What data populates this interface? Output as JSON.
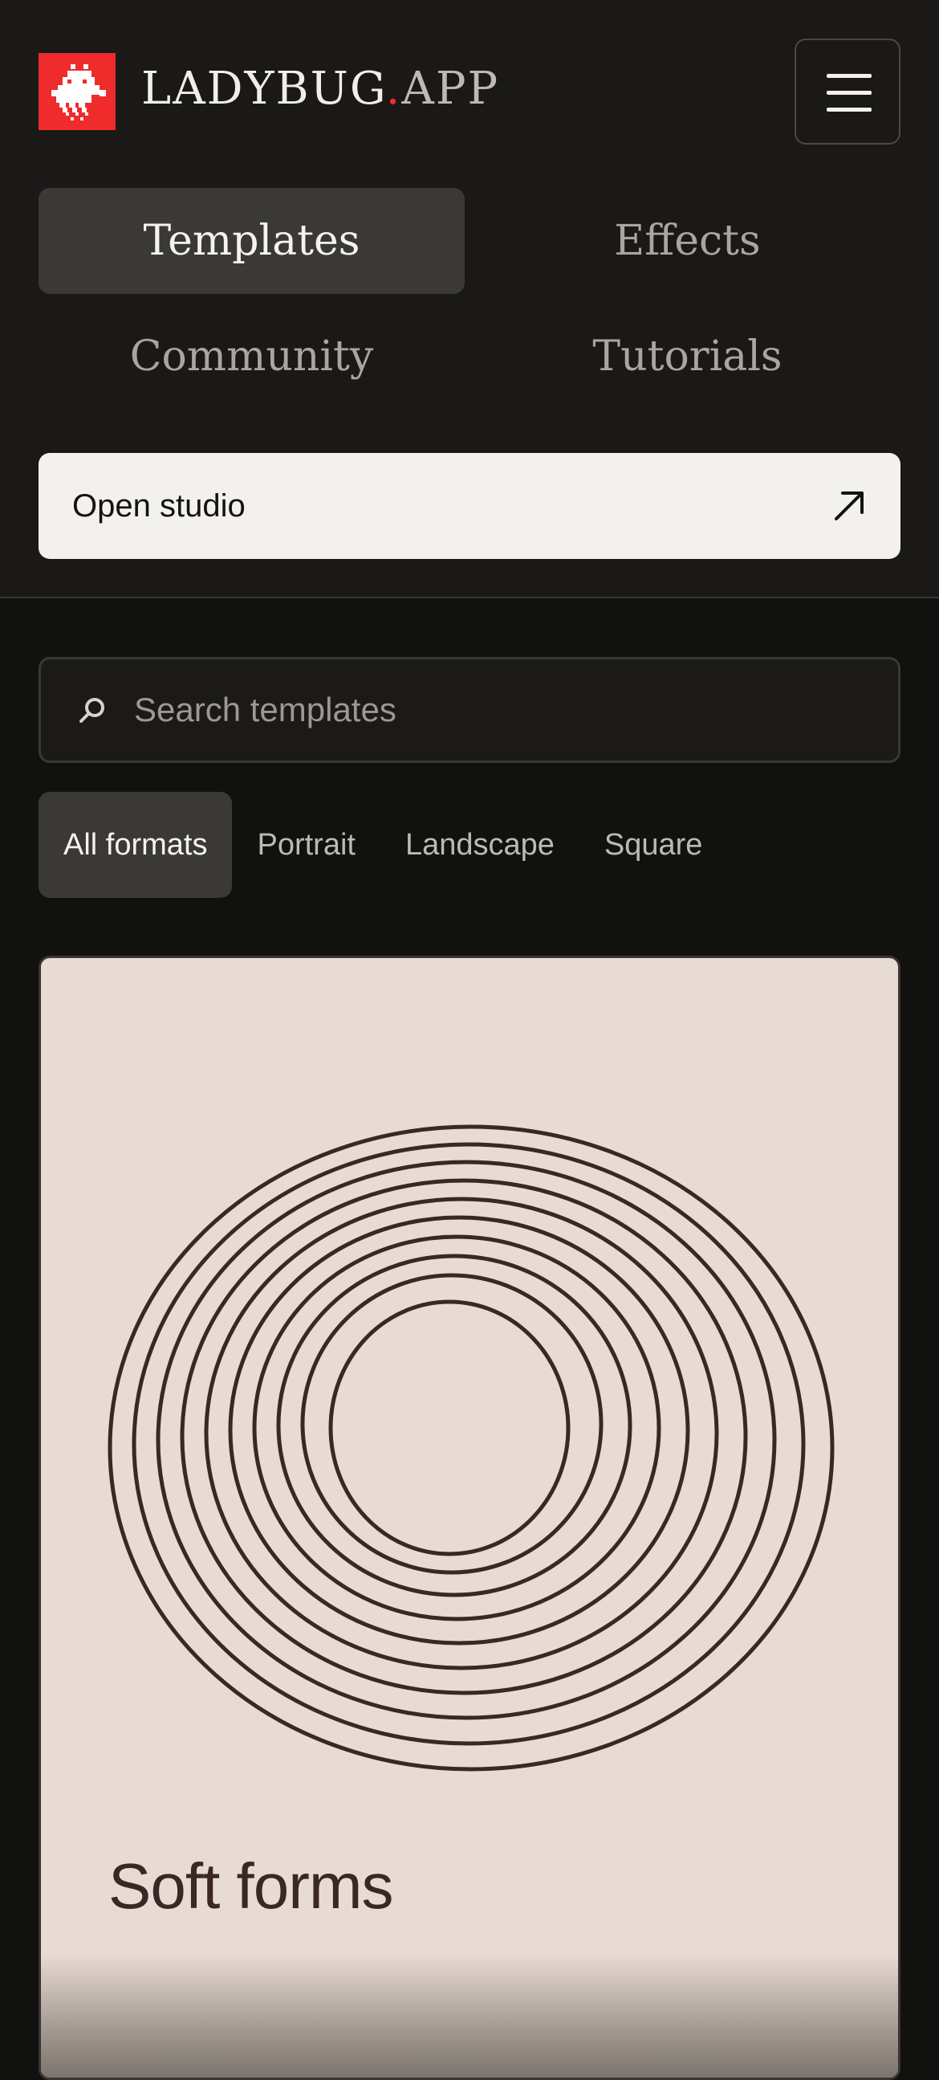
{
  "header": {
    "brand_name": "LADYBUG",
    "brand_dot": ".",
    "brand_tld": "APP",
    "logo_icon": "ladybug-pixel-icon",
    "menu_icon": "hamburger-menu-icon"
  },
  "nav": {
    "items": [
      {
        "label": "Templates",
        "active": true
      },
      {
        "label": "Effects",
        "active": false
      },
      {
        "label": "Community",
        "active": false
      },
      {
        "label": "Tutorials",
        "active": false
      }
    ]
  },
  "open_studio": {
    "label": "Open studio",
    "icon": "arrow-up-right-icon"
  },
  "search": {
    "placeholder": "Search templates",
    "value": "",
    "icon": "search-icon"
  },
  "filters": {
    "items": [
      {
        "label": "All formats",
        "active": true
      },
      {
        "label": "Portrait",
        "active": false
      },
      {
        "label": "Landscape",
        "active": false
      },
      {
        "label": "Square",
        "active": false
      }
    ]
  },
  "templates": [
    {
      "title": "Soft forms",
      "background": "#e8dbd3",
      "stroke": "#3b2725"
    }
  ],
  "colors": {
    "accent": "#ef2b2b",
    "page_bg": "#111110",
    "header_bg": "#1a1918",
    "active_bg": "#3a3937"
  }
}
